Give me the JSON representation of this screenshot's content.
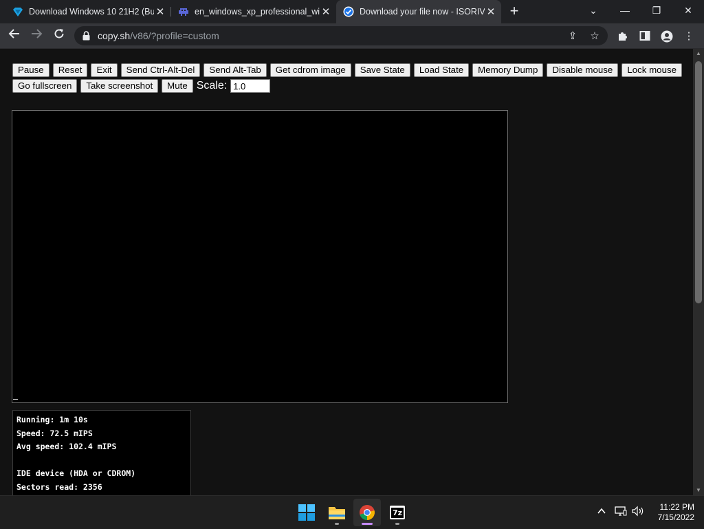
{
  "tabs": [
    {
      "title": "Download Windows 10 21H2 (Bu",
      "favicon": "diamond-blue-icon"
    },
    {
      "title": "en_windows_xp_professional_with",
      "favicon": "space-invader-icon"
    },
    {
      "title": "Download your file now - ISORIV",
      "favicon": "check-circle-icon"
    }
  ],
  "address_bar": {
    "host": "copy.sh",
    "path": "/v86/?profile=custom"
  },
  "controls": {
    "row1": [
      "Pause",
      "Reset",
      "Exit",
      "Send Ctrl-Alt-Del",
      "Send Alt-Tab",
      "Get cdrom image",
      "Save State",
      "Load State",
      "Memory Dump",
      "Disable mouse",
      "Lock mouse"
    ],
    "row2": [
      "Go fullscreen",
      "Take screenshot",
      "Mute"
    ],
    "scale_label": "Scale:",
    "scale_value": "1.0"
  },
  "stats": {
    "running": "Running: 1m 10s",
    "speed": "Speed: 72.5 mIPS",
    "avg_speed": "Avg speed: 102.4 mIPS",
    "ide_header": "IDE device (HDA or CDROM)",
    "sectors_read": "Sectors read: 2356"
  },
  "taskbar": {
    "apps": [
      "windows-start-icon",
      "file-explorer-icon",
      "chrome-icon",
      "7zip-icon"
    ],
    "clock_time": "11:22 PM",
    "clock_date": "7/15/2022",
    "seven_zip_label": "7z"
  },
  "colors": {
    "tab_bg": "#202124",
    "toolbar_bg": "#35363a",
    "page_bg": "#121212",
    "active_indicator": "#c58af9"
  }
}
